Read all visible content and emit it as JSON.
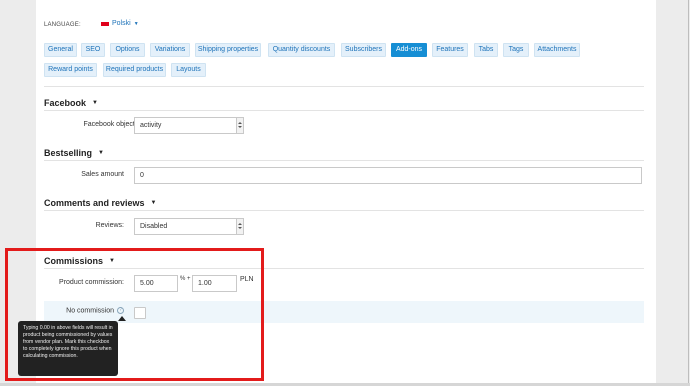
{
  "language": {
    "label": "LANGUAGE:",
    "value": "Polski"
  },
  "tabs": [
    {
      "label": "General"
    },
    {
      "label": "SEO"
    },
    {
      "label": "Options"
    },
    {
      "label": "Variations"
    },
    {
      "label": "Shipping properties"
    },
    {
      "label": "Quantity discounts"
    },
    {
      "label": "Subscribers"
    },
    {
      "label": "Add-ons"
    },
    {
      "label": "Features"
    },
    {
      "label": "Tabs"
    },
    {
      "label": "Tags"
    },
    {
      "label": "Attachments"
    },
    {
      "label": "Reward points"
    },
    {
      "label": "Required products"
    },
    {
      "label": "Layouts"
    }
  ],
  "active_tab": "Add-ons",
  "facebook": {
    "title": "Facebook",
    "object_type_label": "Facebook object type:",
    "object_type_value": "activity"
  },
  "bestselling": {
    "title": "Bestselling",
    "sales_amount_label": "Sales amount",
    "sales_amount_value": "0"
  },
  "comments": {
    "title": "Comments and reviews",
    "reviews_label": "Reviews:",
    "reviews_value": "Disabled"
  },
  "commissions": {
    "title": "Commissions",
    "product_commission_label": "Product commission:",
    "percent_value": "5.00",
    "percent_suffix": "% +",
    "fixed_value": "1.00",
    "currency": "PLN",
    "no_commission_label": "No commission",
    "tooltip": "Typing 0.00 in above fields will result in product being commissioned by values from vendor plan. Mark this checkbox to completely ignore this product when calculating commission."
  },
  "colors": {
    "accent": "#168ed4",
    "highlight_box": "#e31b1b",
    "tab_bg": "#e4f0fa",
    "row_highlight": "#eef6fb"
  }
}
